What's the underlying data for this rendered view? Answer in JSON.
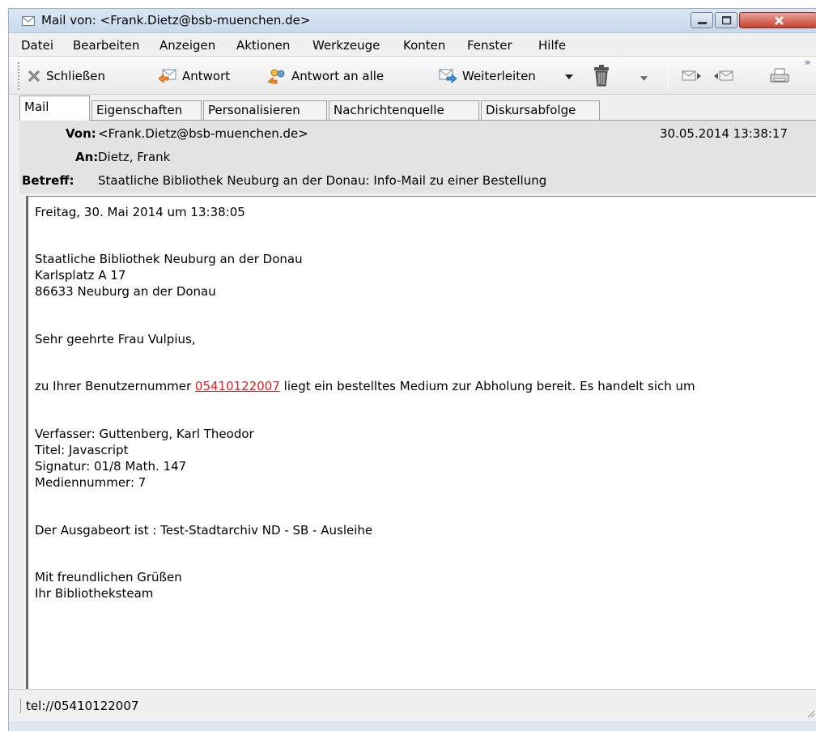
{
  "window": {
    "title": "Mail von: <Frank.Dietz@bsb-muenchen.de>"
  },
  "menu": [
    "Datei",
    "Bearbeiten",
    "Anzeigen",
    "Aktionen",
    "Werkzeuge",
    "Konten",
    "Fenster",
    "Hilfe"
  ],
  "toolbar": {
    "close_label": "Schließen",
    "reply_label": "Antwort",
    "reply_all_label": "Antwort an alle",
    "forward_label": "Weiterleiten",
    "overflow": "»"
  },
  "tabs": [
    "Mail",
    "Eigenschaften",
    "Personalisieren",
    "Nachrichtenquelle",
    "Diskursabfolge"
  ],
  "header": {
    "from_label": "Von:",
    "from_value": "<Frank.Dietz@bsb-muenchen.de>",
    "date": "30.05.2014 13:38:17",
    "to_label": "An:",
    "to_value": "Dietz, Frank",
    "subject_label": "Betreff:",
    "subject_value": "Staatliche Bibliothek Neuburg an der Donau: Info-Mail zu einer Bestellung"
  },
  "body": {
    "dateline": "Freitag, 30. Mai 2014 um 13:38:05",
    "address": [
      "Staatliche Bibliothek Neuburg an der Donau",
      "Karlsplatz A 17",
      "86633 Neuburg an der Donau"
    ],
    "salutation": "Sehr geehrte Frau Vulpius,",
    "intro_before": "zu Ihrer Benutzernummer ",
    "user_number": "05410122007",
    "intro_after": " liegt ein bestelltes Medium zur Abholung bereit. Es handelt sich um",
    "details": [
      "Verfasser: Guttenberg, Karl Theodor",
      "Titel: Javascript",
      "Signatur: 01/8 Math. 147",
      "Mediennummer: 7"
    ],
    "pickup": "Der Ausgabeort ist : Test-Stadtarchiv ND - SB - Ausleihe",
    "closing": [
      "Mit freundlichen Grüßen",
      "Ihr Bibliotheksteam"
    ]
  },
  "status": {
    "text": "tel://05410122007"
  },
  "colors": {
    "link": "#e02020",
    "close_button": "#c7432f",
    "header_bg": "#e3e3e3"
  }
}
